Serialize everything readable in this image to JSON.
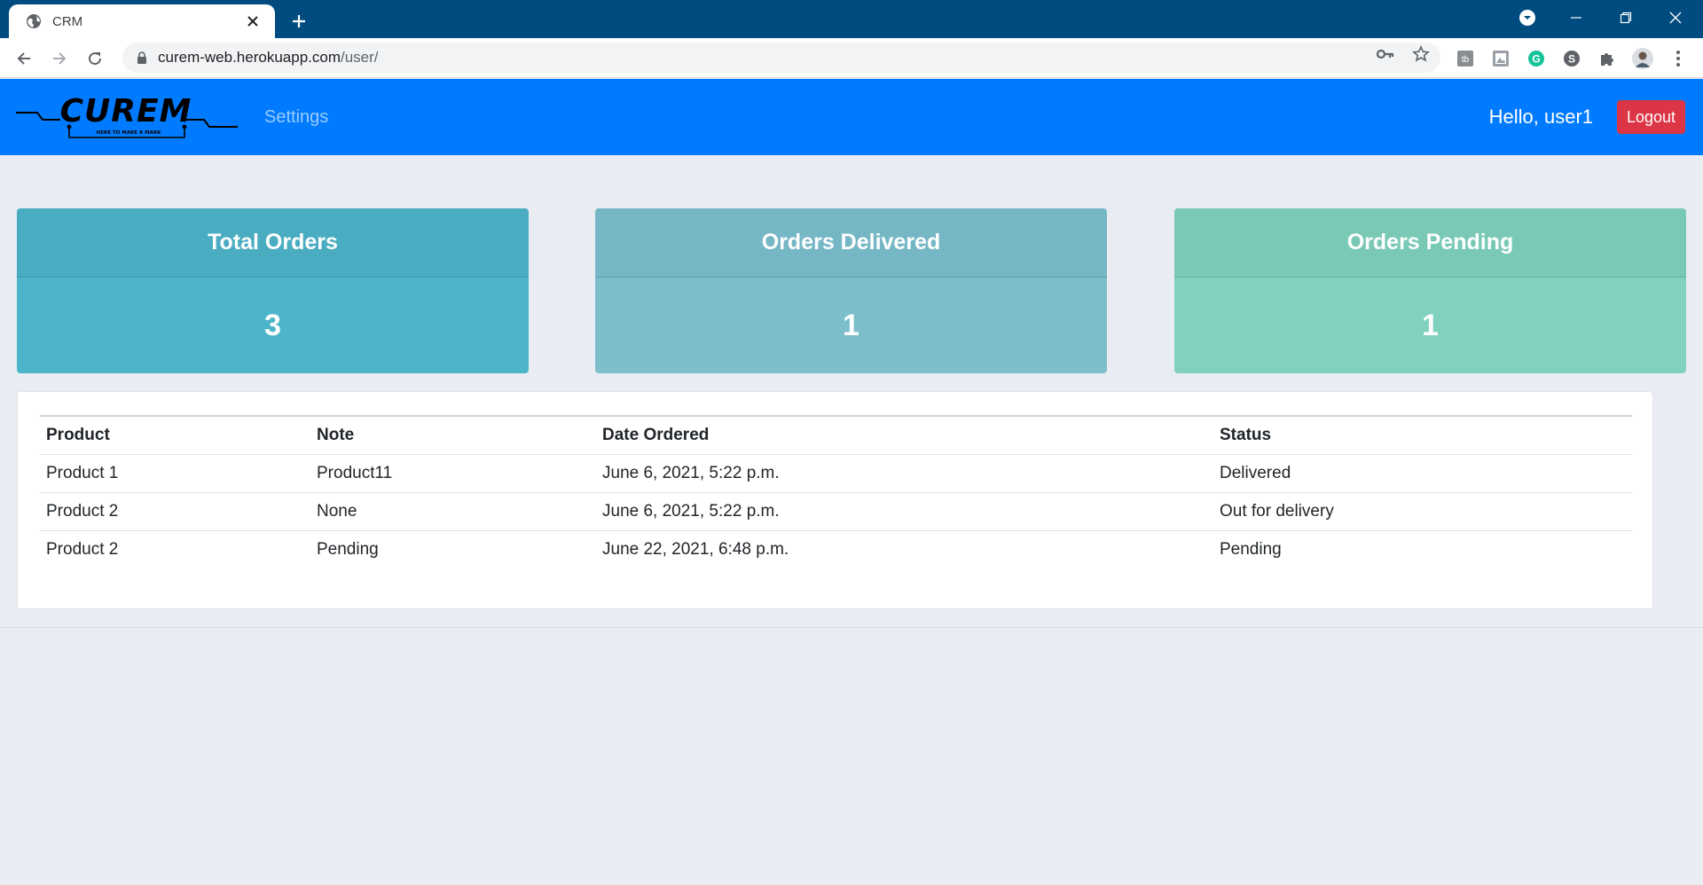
{
  "browser": {
    "tab_title": "CRM",
    "url_host": "curem-web.herokuapp.com",
    "url_path": "/user/"
  },
  "navbar": {
    "brand_text": "CUREM",
    "brand_tagline": "HERE TO MAKE A MARK",
    "settings_label": "Settings",
    "greeting": "Hello, user1",
    "logout_label": "Logout",
    "color": "#007bff"
  },
  "stats": [
    {
      "title": "Total Orders",
      "value": "3",
      "head_color": "#4aacc1",
      "body_color": "#4db5c9"
    },
    {
      "title": "Orders Delivered",
      "value": "1",
      "head_color": "#76b7c5",
      "body_color": "#7cbfcb"
    },
    {
      "title": "Orders Pending",
      "value": "1",
      "head_color": "#79c9b6",
      "body_color": "#80d2bf"
    }
  ],
  "orders": {
    "headers": [
      "Product",
      "Note",
      "Date Ordered",
      "Status"
    ],
    "rows": [
      [
        "Product 1",
        "Product11",
        "June 6, 2021, 5:22 p.m.",
        "Delivered"
      ],
      [
        "Product 2",
        "None",
        "June 6, 2021, 5:22 p.m.",
        "Out for delivery"
      ],
      [
        "Product 2",
        "Pending",
        "June 22, 2021, 6:48 p.m.",
        "Pending"
      ]
    ]
  },
  "icons": {
    "tab_favicon": "globe-icon",
    "lock": "lock-icon",
    "password_key": "key-icon",
    "bookmark": "star-icon",
    "extensions": "puzzle-icon",
    "menu": "kebab-menu-icon"
  }
}
